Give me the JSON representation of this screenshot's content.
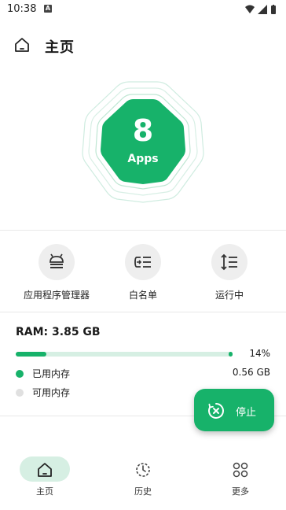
{
  "status_bar": {
    "time": "10:38"
  },
  "app_bar": {
    "title": "主页"
  },
  "hero": {
    "count": "8",
    "label": "Apps"
  },
  "actions": [
    {
      "label": "应用程序管理器"
    },
    {
      "label": "白名单"
    },
    {
      "label": "运行中"
    }
  ],
  "ram": {
    "title": "RAM: 3.85 GB",
    "percent_text": "14%",
    "used_fraction": 0.14,
    "used_label": "已用内存",
    "used_value": "0.56 GB",
    "free_label": "可用内存"
  },
  "fab": {
    "label": "停止"
  },
  "bottom_nav": [
    {
      "label": "主页",
      "active": true
    },
    {
      "label": "历史",
      "active": false
    },
    {
      "label": "更多",
      "active": false
    }
  ],
  "colors": {
    "accent": "#17b26a",
    "accent_light": "#d6efe3",
    "free_dot": "#e0e0e0"
  }
}
